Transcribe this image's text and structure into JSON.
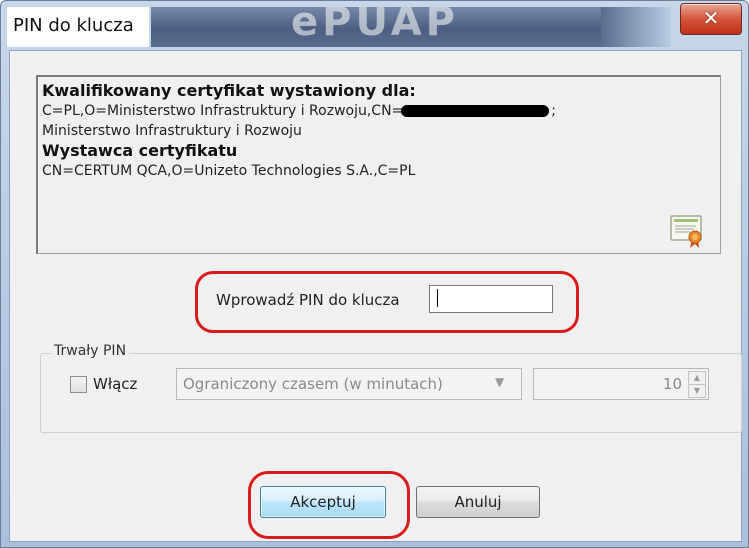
{
  "window": {
    "title": "PIN do klucza",
    "banner_text": "ePUAP",
    "close_symbol": "✕"
  },
  "certificate": {
    "subject_heading": "Kwalifikowany certyfikat wystawiony dla:",
    "subject_line1_prefix": "C=PL,O=Ministerstwo Infrastruktury i Rozwoju,CN=",
    "subject_line1_suffix": ";",
    "subject_line2": "Ministerstwo Infrastruktury i Rozwoju",
    "issuer_heading": "Wystawca certyfikatu",
    "issuer_line": "CN=CERTUM QCA,O=Unizeto Technologies S.A.,C=PL",
    "icon": "certificate-icon"
  },
  "pin": {
    "label": "Wprowadź PIN do klucza",
    "value": ""
  },
  "persistent_pin": {
    "legend": "Trwały PIN",
    "enable_label": "Włącz",
    "enabled": false,
    "mode_value": "Ograniczony czasem (w minutach)",
    "minutes_value": "10"
  },
  "buttons": {
    "accept_label": "Akceptuj",
    "cancel_label": "Anuluj"
  },
  "colors": {
    "highlight": "#d91b1b",
    "close_button": "#c0301a",
    "default_button_border": "#3c7fb1"
  }
}
